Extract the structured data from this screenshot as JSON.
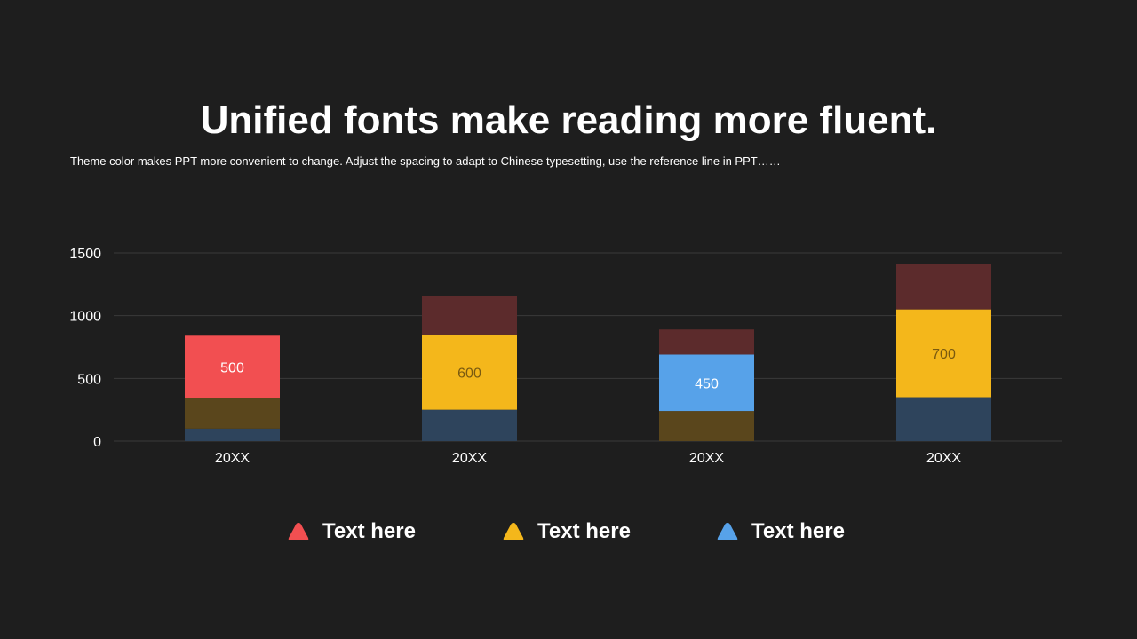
{
  "slide": {
    "title": "Unified fonts make reading more fluent.",
    "subtitle": "Theme color makes PPT more convenient to change. Adjust the spacing to adapt to Chinese typesetting, use the reference line in PPT……"
  },
  "chart_data": {
    "type": "bar",
    "stacked": true,
    "categories": [
      "20XX",
      "20XX",
      "20XX",
      "20XX"
    ],
    "series": [
      {
        "values": [
          100,
          250,
          0,
          350
        ],
        "color": "#2e445c"
      },
      {
        "values": [
          240,
          0,
          240,
          0
        ],
        "color": "#5a461c"
      },
      {
        "values": [
          500,
          0,
          0,
          0
        ],
        "color": "#f24f51",
        "labels": [
          "500",
          "",
          "",
          ""
        ],
        "label_color": "#ffffff"
      },
      {
        "values": [
          0,
          600,
          0,
          700
        ],
        "color": "#f4b71b",
        "labels": [
          "",
          "600",
          "",
          "700"
        ],
        "label_color": "#7a5a10"
      },
      {
        "values": [
          0,
          0,
          450,
          0
        ],
        "color": "#57a2e9",
        "labels": [
          "",
          "",
          "450",
          ""
        ],
        "label_color": "#ffffff"
      },
      {
        "values": [
          0,
          310,
          200,
          360
        ],
        "color": "#5c2b2c"
      }
    ],
    "ylim": [
      0,
      1500
    ],
    "yticks": [
      0,
      500,
      1000,
      1500
    ],
    "ytick_labels": [
      "0",
      "500",
      "1000",
      "1500"
    ],
    "grid": true,
    "legend": [
      {
        "label": "Text here",
        "color": "#f24f51",
        "icon": "triangle-icon"
      },
      {
        "label": "Text here",
        "color": "#f4b71b",
        "icon": "triangle-icon"
      },
      {
        "label": "Text here",
        "color": "#57a2e9",
        "icon": "triangle-icon"
      }
    ],
    "legend_position": "bottom"
  }
}
